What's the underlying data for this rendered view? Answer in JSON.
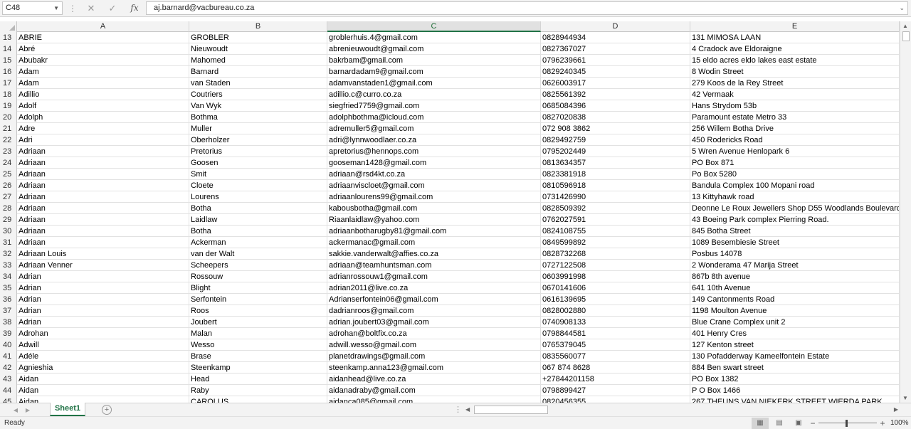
{
  "formula_bar": {
    "name_box": "C48",
    "cancel_icon": "✕",
    "enter_icon": "✓",
    "fx_label": "fx",
    "content": "aj.barnard@vacbureau.co.za"
  },
  "columns": [
    "A",
    "B",
    "C",
    "D",
    "E"
  ],
  "active_column": "C",
  "rows": [
    {
      "n": "13",
      "a": "ABRIE",
      "b": "GROBLER",
      "c": "groblerhuis.4@gmail.com",
      "d": "0828944934",
      "e": "131 MIMOSA LAAN"
    },
    {
      "n": "14",
      "a": "Abré",
      "b": "Nieuwoudt",
      "c": "abrenieuwoudt@gmail.com",
      "d": "0827367027",
      "e": "4 Cradock ave Eldoraigne"
    },
    {
      "n": "15",
      "a": "Abubakr",
      "b": "Mahomed",
      "c": "bakrbam@gmail.com",
      "d": "0796239661",
      "e": "15 eldo acres eldo lakes east estate"
    },
    {
      "n": "16",
      "a": "Adam",
      "b": "Barnard",
      "c": "barnardadam9@gmail.com",
      "d": "0829240345",
      "e": "8 Wodin Street"
    },
    {
      "n": "17",
      "a": "Adam",
      "b": "van Staden",
      "c": "adamvanstaden1@gmail.com",
      "d": "0626003917",
      "e": "279 Koos de la Rey Street"
    },
    {
      "n": "18",
      "a": "Adillio",
      "b": "Coutriers",
      "c": "adillio.c@curro.co.za",
      "d": "0825561392",
      "e": "42 Vermaak"
    },
    {
      "n": "19",
      "a": "Adolf",
      "b": "Van Wyk",
      "c": "siegfried7759@gmail.com",
      "d": "0685084396",
      "e": "Hans Strydom 53b"
    },
    {
      "n": "20",
      "a": "Adolph",
      "b": "Bothma",
      "c": "adolphbothma@icloud.com",
      "d": "0827020838",
      "e": "Paramount estate Metro 33"
    },
    {
      "n": "21",
      "a": "Adre",
      "b": "Muller",
      "c": "adremuller5@gmail.com",
      "d": "072 908 3862",
      "e": "256 Willem Botha Drive"
    },
    {
      "n": "22",
      "a": "Adri",
      "b": "Oberholzer",
      "c": "adri@lynnwoodlaer.co.za",
      "d": "0829492759",
      "e": "450 Rodericks Road"
    },
    {
      "n": "23",
      "a": "Adriaan",
      "b": "Pretorius",
      "c": "apretorius@hennops.com",
      "d": "0795202449",
      "e": "5 Wren Avenue Henlopark 6"
    },
    {
      "n": "24",
      "a": "Adriaan",
      "b": "Goosen",
      "c": "gooseman1428@gmail.com",
      "d": "0813634357",
      "e": "PO Box 871"
    },
    {
      "n": "25",
      "a": "Adriaan",
      "b": "Smit",
      "c": "adriaan@rsd4kt.co.za",
      "d": "0823381918",
      "e": "Po Box 5280"
    },
    {
      "n": "26",
      "a": "Adriaan",
      "b": "Cloete",
      "c": "adriaanviscloet@gmail.com",
      "d": "0810596918",
      "e": "Bandula Complex   100 Mopani road"
    },
    {
      "n": "27",
      "a": "Adriaan",
      "b": "Lourens",
      "c": "adriaanlourens99@gmail.com",
      "d": "0731426990",
      "e": "13 Kittyhawk road"
    },
    {
      "n": "28",
      "a": "Adriaan",
      "b": "Botha",
      "c": "kabousbotha@gmail.com",
      "d": "0828509392",
      "e": "Deonne Le Roux Jewellers Shop D55 Woodlands Boulevard"
    },
    {
      "n": "29",
      "a": "Adriaan",
      "b": "Laidlaw",
      "c": "Riaanlaidlaw@yahoo.com",
      "d": "0762027591",
      "e": "43 Boeing Park complex Pierring Road."
    },
    {
      "n": "30",
      "a": "Adriaan",
      "b": "Botha",
      "c": "adriaanbotharugby81@gmail.com",
      "d": "0824108755",
      "e": "845 Botha Street"
    },
    {
      "n": "31",
      "a": "Adriaan",
      "b": "Ackerman",
      "c": "ackermanac@gmail.com",
      "d": "0849599892",
      "e": "1089 Besembiesie Street"
    },
    {
      "n": "32",
      "a": "Adriaan Louis",
      "b": "van der Walt",
      "c": "sakkie.vanderwalt@affies.co.za",
      "d": "0828732268",
      "e": "Posbus 14078"
    },
    {
      "n": "33",
      "a": "Adriaan Venner",
      "b": "Scheepers",
      "c": "adriaan@teamhuntsman.com",
      "d": "0727122508",
      "e": "2 Wonderama 47 Marija Street"
    },
    {
      "n": "34",
      "a": "Adrian",
      "b": "Rossouw",
      "c": "adrianrossouw1@gmail.com",
      "d": "0603991998",
      "e": "867b 8th avenue"
    },
    {
      "n": "35",
      "a": "Adrian",
      "b": "Blight",
      "c": "adrian2011@live.co.za",
      "d": "0670141606",
      "e": "641 10th Avenue"
    },
    {
      "n": "36",
      "a": "Adrian",
      "b": "Serfontein",
      "c": "Adrianserfontein06@gmail.com",
      "d": "0616139695",
      "e": "149 Cantonments Road"
    },
    {
      "n": "37",
      "a": "Adrian",
      "b": "Roos",
      "c": "dadrianroos@gmail.com",
      "d": "0828002880",
      "e": "1198 Moulton Avenue"
    },
    {
      "n": "38",
      "a": "Adrian",
      "b": "Joubert",
      "c": "adrian.joubert03@gmail.com",
      "d": "0740908133",
      "e": "Blue Crane Complex unit 2"
    },
    {
      "n": "39",
      "a": "Adrohan",
      "b": "Malan",
      "c": "adrohan@boltfix.co.za",
      "d": "0798844581",
      "e": "401 Henry Cres"
    },
    {
      "n": "40",
      "a": "Adwill",
      "b": "Wesso",
      "c": "adwill.wesso@gmail.com",
      "d": "0765379045",
      "e": "127 Kenton street"
    },
    {
      "n": "41",
      "a": "Adéle",
      "b": "Brase",
      "c": "planetdrawings@gmail.com",
      "d": "0835560077",
      "e": "130 Pofadderway Kameelfontein Estate"
    },
    {
      "n": "42",
      "a": "Agnieshia",
      "b": "Steenkamp",
      "c": "steenkamp.anna123@gmail.com",
      "d": "067 874 8628",
      "e": "884 Ben swart street"
    },
    {
      "n": "43",
      "a": "Aidan",
      "b": "Head",
      "c": "aidanhead@live.co.za",
      "d": "+27844201158",
      "e": "PO Box 1382"
    },
    {
      "n": "44",
      "a": "Aidan",
      "b": "Raby",
      "c": "aidanadraby@gmail.com",
      "d": "0798899427",
      "e": "P O Box 1466"
    },
    {
      "n": "45",
      "a": "Aidan",
      "b": "CAROLUS",
      "c": "aidanca085@gmail.com",
      "d": "0820456355",
      "e": "267 THEUNS VAN NIEKERK STREET WIERDA PARK"
    }
  ],
  "sheet_tabs": {
    "active": "Sheet1",
    "add_icon": "+"
  },
  "status_bar": {
    "status": "Ready",
    "zoom": "100%",
    "zoom_minus": "−",
    "zoom_plus": "+"
  },
  "icons": {
    "name_box_dropdown": "chevron-down-icon",
    "cancel": "close-icon",
    "enter": "check-icon",
    "fx": "function-icon",
    "add_sheet": "plus-circle-icon",
    "normal_view": "grid-view-icon",
    "page_layout_view": "page-layout-icon",
    "page_break_view": "page-break-icon"
  },
  "colors": {
    "accent": "#217346"
  }
}
